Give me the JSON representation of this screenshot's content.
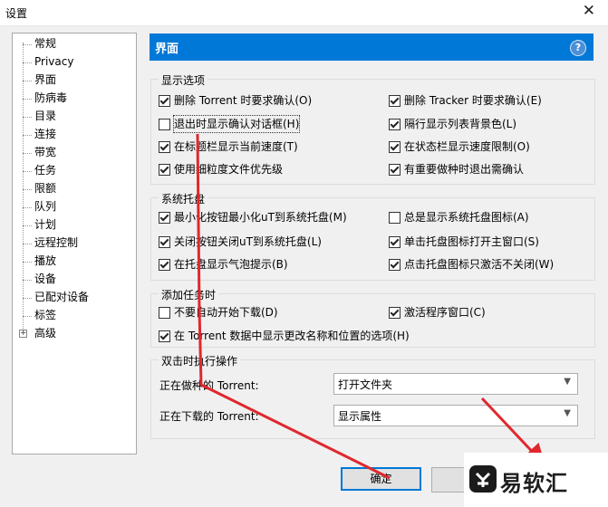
{
  "window": {
    "title": "设置"
  },
  "tree": {
    "items": [
      "常规",
      "Privacy",
      "界面",
      "防病毒",
      "目录",
      "连接",
      "带宽",
      "任务",
      "限额",
      "队列",
      "计划",
      "远程控制",
      "播放",
      "设备",
      "已配对设备",
      "标签",
      "高级"
    ]
  },
  "header": {
    "title": "界面"
  },
  "display_options": {
    "legend": "显示选项",
    "items": [
      {
        "label": "删除 Torrent 时要求确认(O)",
        "checked": true
      },
      {
        "label": "删除 Tracker 时要求确认(E)",
        "checked": true
      },
      {
        "label": "退出时显示确认对话框(H)",
        "checked": false
      },
      {
        "label": "隔行显示列表背景色(L)",
        "checked": true
      },
      {
        "label": "在标题栏显示当前速度(T)",
        "checked": true
      },
      {
        "label": "在状态栏显示速度限制(O)",
        "checked": true
      },
      {
        "label": "使用细粒度文件优先级",
        "checked": true
      },
      {
        "label": "有重要做种时退出需确认",
        "checked": true
      }
    ]
  },
  "system_tray": {
    "legend": "系统托盘",
    "items": [
      {
        "label": "最小化按钮最小化uT到系统托盘(M)",
        "checked": true
      },
      {
        "label": "总是显示系统托盘图标(A)",
        "checked": false
      },
      {
        "label": "关闭按钮关闭uT到系统托盘(L)",
        "checked": true
      },
      {
        "label": "单击托盘图标打开主窗口(S)",
        "checked": true
      },
      {
        "label": "在托盘显示气泡提示(B)",
        "checked": true
      },
      {
        "label": "点击托盘图标只激活不关闭(W)",
        "checked": true
      }
    ]
  },
  "add_task": {
    "legend": "添加任务时",
    "items": [
      {
        "label": "不要自动开始下载(D)",
        "checked": false
      },
      {
        "label": "激活程序窗口(C)",
        "checked": true
      },
      {
        "label": "在 Torrent 数据中显示更改名称和位置的选项(H)",
        "checked": true
      }
    ]
  },
  "double_click": {
    "legend": "双击时执行操作",
    "seeding_label": "正在做种的 Torrent:",
    "seeding_value": "打开文件夹",
    "downloading_label": "正在下载的 Torrent:",
    "downloading_value": "显示属性"
  },
  "buttons": {
    "ok": "确定"
  },
  "watermark": {
    "text": "易软汇"
  },
  "colors": {
    "accent": "#0078d7",
    "annotation": "#e0272e"
  }
}
